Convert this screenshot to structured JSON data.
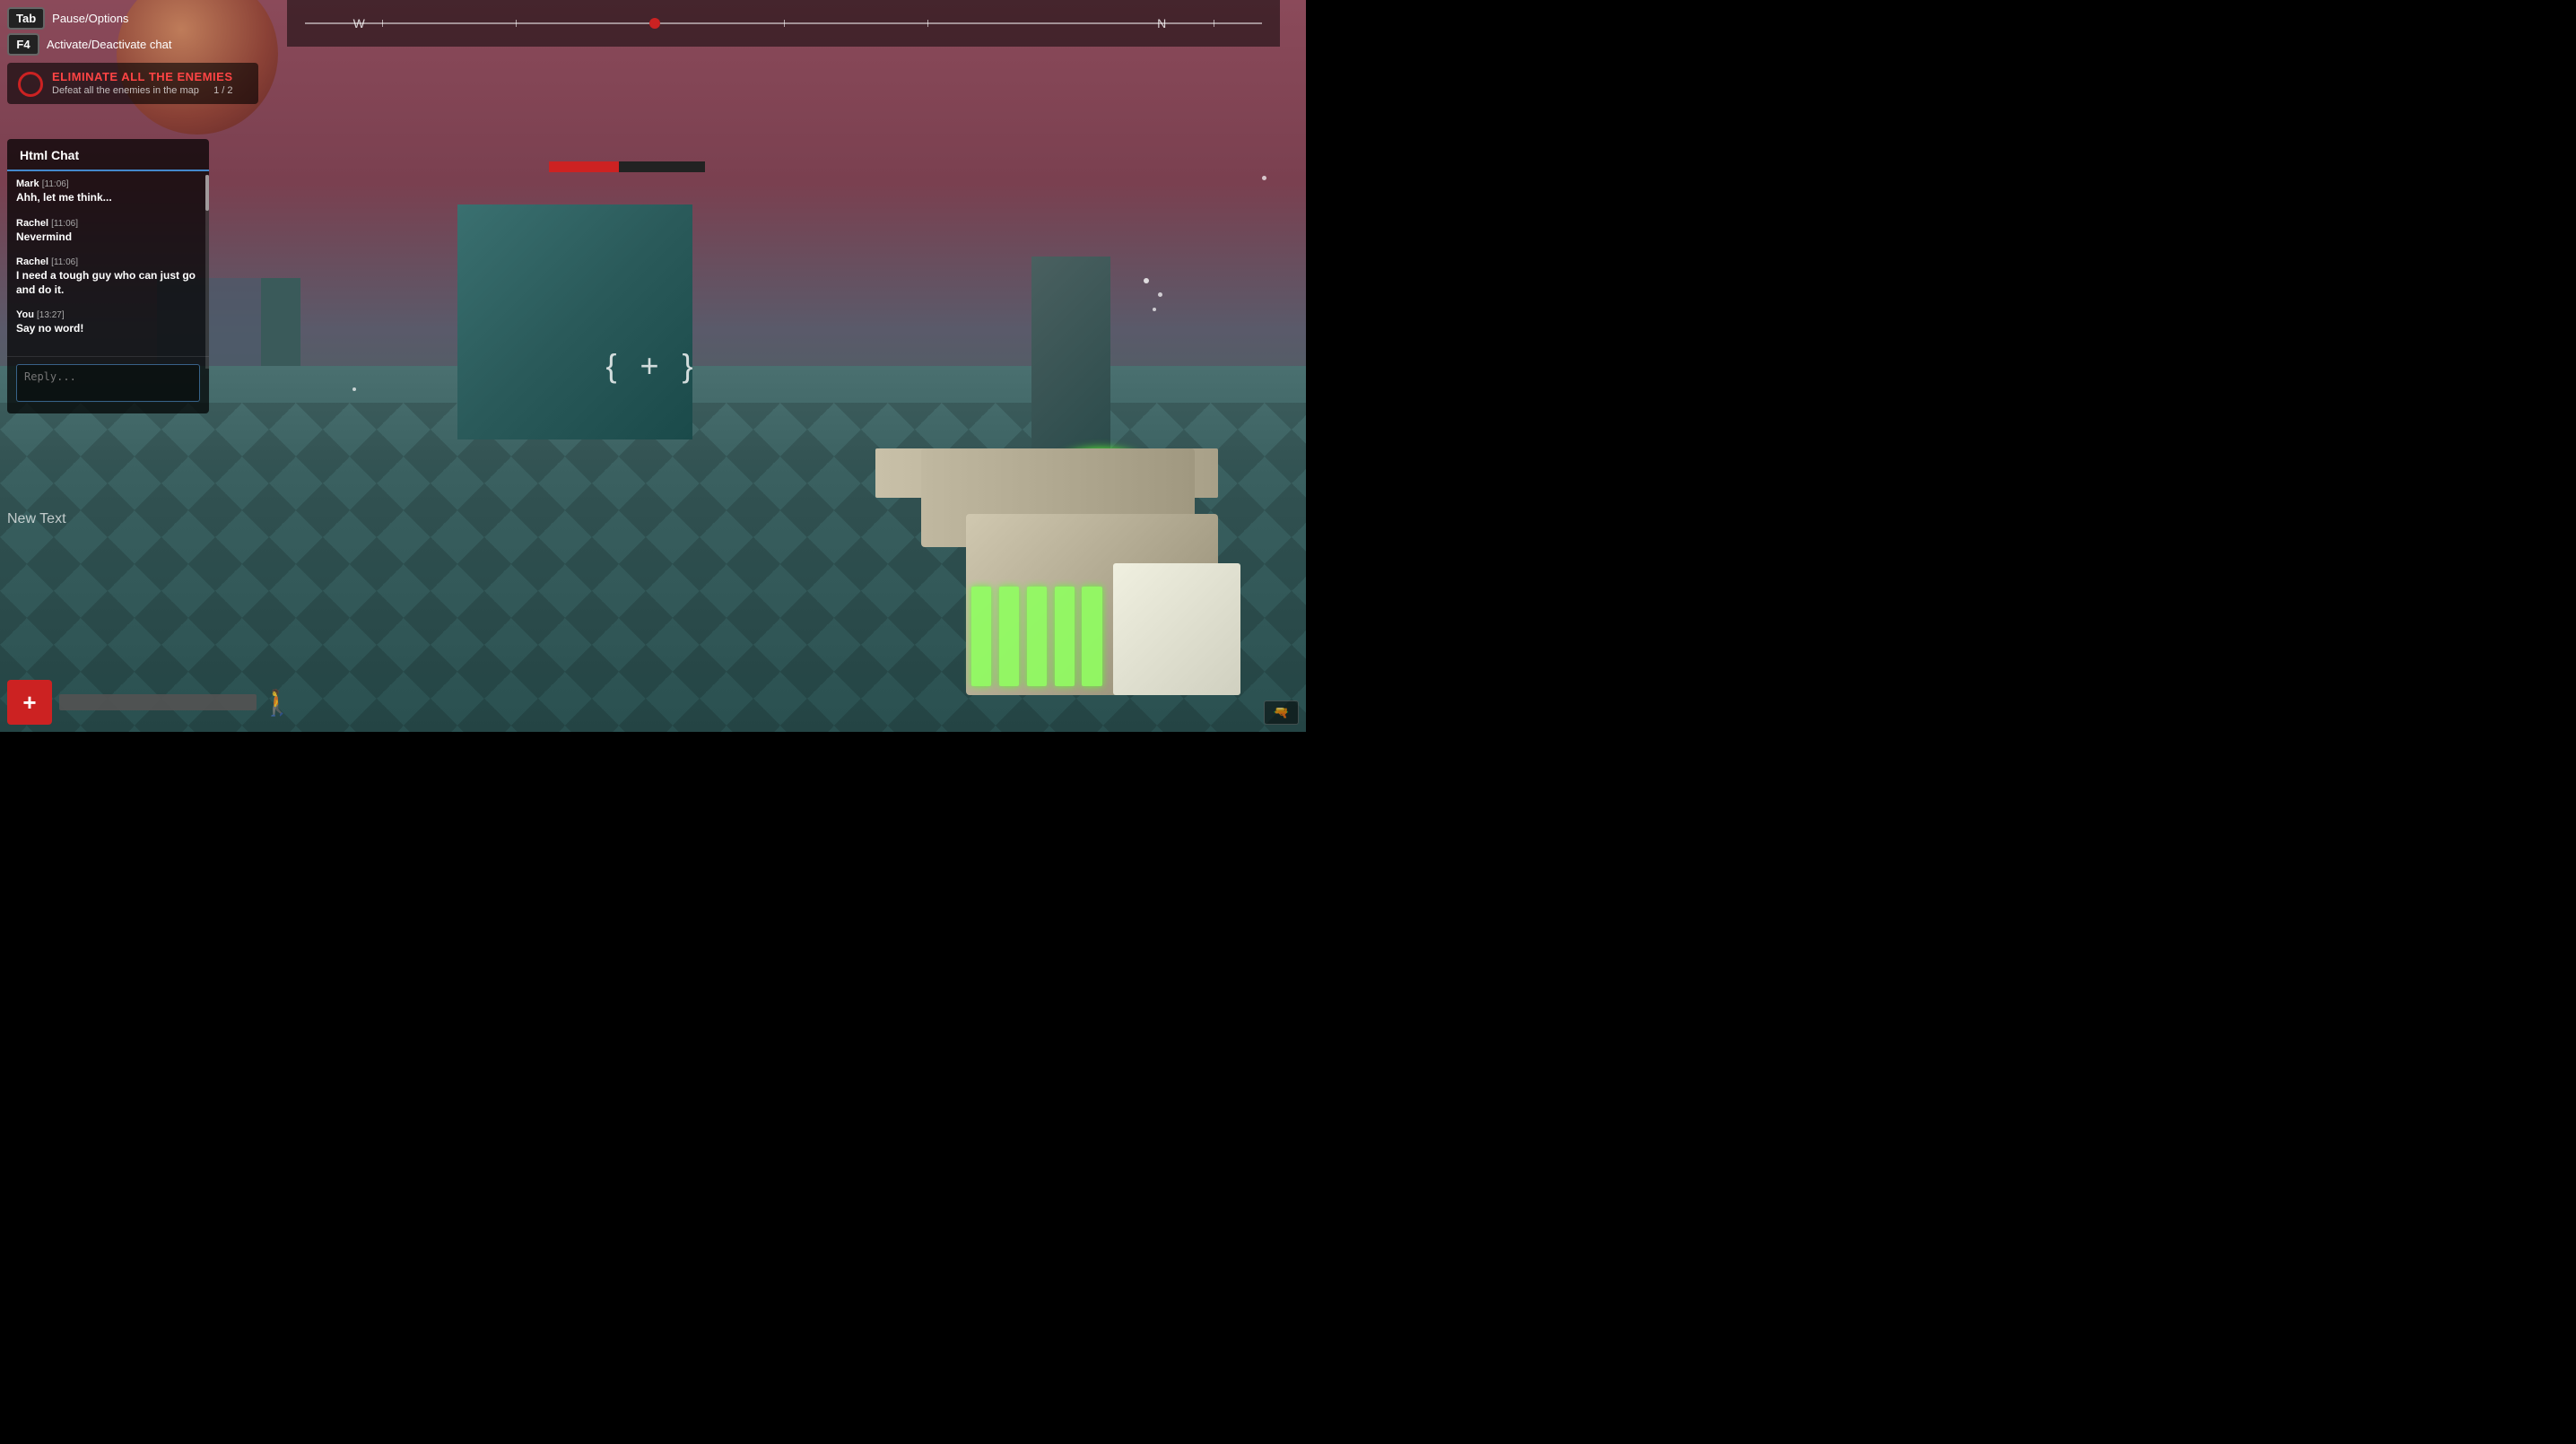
{
  "keybindings": {
    "items": [
      {
        "key": "Tab",
        "label": "Pause/Options"
      },
      {
        "key": "F4",
        "label": "Activate/Deactivate chat"
      }
    ]
  },
  "objective": {
    "title": "ELIMINATE ALL THE ENEMIES",
    "description": "Defeat all the enemies in the map",
    "count": "1 / 2"
  },
  "chat": {
    "title": "Html Chat",
    "messages": [
      {
        "sender": "Mark",
        "timestamp": "[11:06]",
        "text": "Ahh, let me think..."
      },
      {
        "sender": "Rachel",
        "timestamp": "[11:06]",
        "text": "Nevermind"
      },
      {
        "sender": "Rachel",
        "timestamp": "[11:06]",
        "text": "I need a tough guy who can just go and do it."
      },
      {
        "sender": "You",
        "timestamp": "[13:27]",
        "text": "Say no word!"
      }
    ],
    "input_placeholder": "Reply..."
  },
  "new_text_label": "New Text",
  "compass": {
    "west_label": "W",
    "north_label": "N"
  },
  "bottom_hud": {
    "health_icon": "+"
  },
  "ammo_display": {
    "icon": "🔫"
  },
  "crosshair": "{  +  }"
}
